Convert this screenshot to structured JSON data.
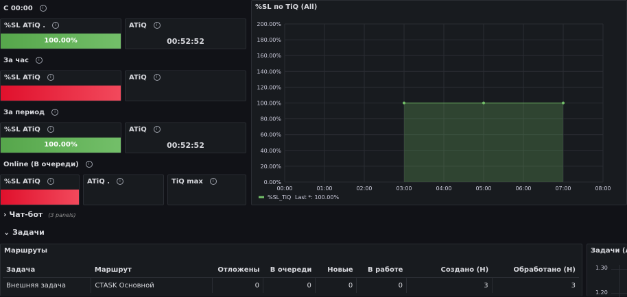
{
  "sections": {
    "since_midnight": "С 00:00",
    "per_hour": "За час",
    "per_period": "За период",
    "online": "Online (В очереди)"
  },
  "stats": {
    "sl_atiq_dot": "%SL ATiQ .",
    "sl_atiq": "%SL ATiQ",
    "atiq": "ATiQ",
    "atiq_dot": "ATiQ .",
    "tiq_max": "TiQ max",
    "c00_sl_value": "100.00%",
    "c00_sl_fill": 1.0,
    "c00_atiq_value": "00:52:52",
    "hour_sl_fill": 1.0,
    "period_sl_value": "100.00%",
    "period_sl_fill": 1.0,
    "period_atiq_value": "00:52:52",
    "online_sl_fill": 1.0
  },
  "chart_panel": {
    "title": "%SL по TiQ (All)"
  },
  "chart_data": {
    "type": "area",
    "x_ticks": [
      "00:00",
      "01:00",
      "02:00",
      "03:00",
      "04:00",
      "05:00",
      "06:00",
      "07:00",
      "08:00"
    ],
    "y_ticks": [
      "0.00%",
      "20.00%",
      "40.00%",
      "60.00%",
      "80.00%",
      "100.00%",
      "120.00%",
      "140.00%",
      "160.00%",
      "180.00%",
      "200.00%"
    ],
    "ylim": [
      0,
      200
    ],
    "series": [
      {
        "name": "%SL_TiQ",
        "x": [
          3,
          5,
          7
        ],
        "values": [
          100,
          100,
          100
        ],
        "color": "#73bf69"
      }
    ],
    "legend": {
      "label": "%SL_TiQ",
      "last": "Last *: 100.00%"
    },
    "grid": true
  },
  "rows": {
    "chatbot": {
      "label": "Чат-бот",
      "panels": "(3 panels)"
    },
    "tasks": {
      "label": "Задачи"
    }
  },
  "routes_panel": {
    "title": "Маршруты",
    "columns": [
      "Задача",
      "Маршрут",
      "Отложены",
      "В очереди",
      "Новые",
      "В работе",
      "Создано (Н)",
      "Обработано (Н)"
    ],
    "rows": [
      [
        "Внешняя задача",
        "CTASK Основной",
        "0",
        "0",
        "0",
        "0",
        "3",
        "3"
      ]
    ]
  },
  "tasks_panel": {
    "title": "Задачи (All",
    "y_ticks": [
      "1.30",
      "1.20"
    ]
  },
  "colors": {
    "green": "#73bf69",
    "red": "#f2495c",
    "background": "#111217",
    "panel": "#181b1f"
  }
}
